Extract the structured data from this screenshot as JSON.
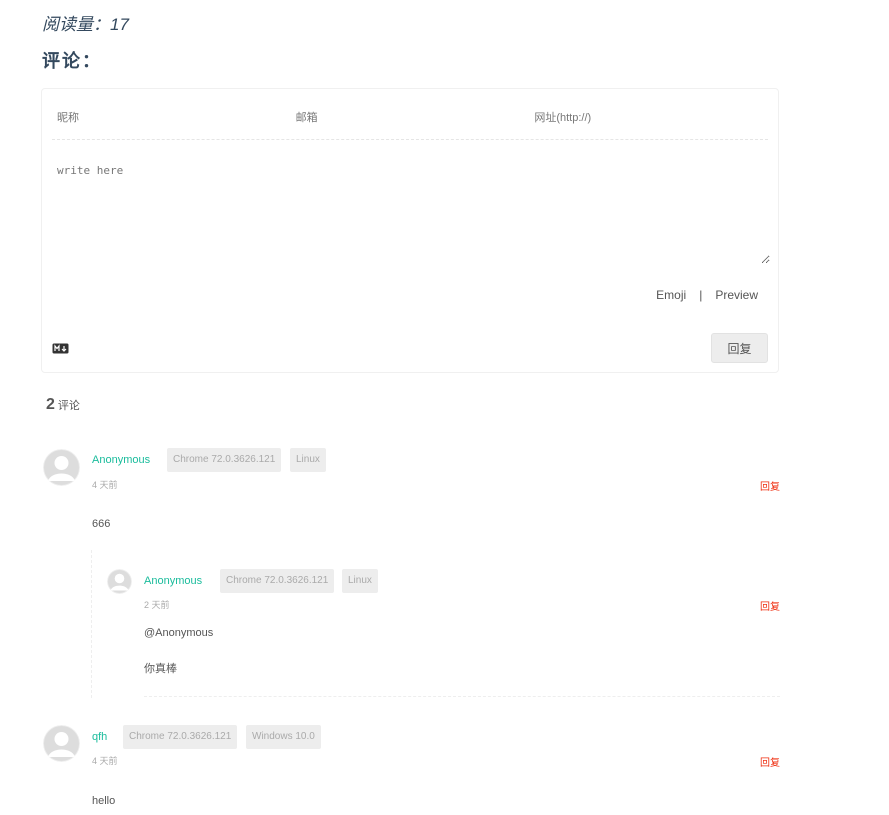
{
  "read_count": "阅读量：17",
  "section_title": "评论：",
  "form": {
    "nick_placeholder": "昵称",
    "mail_placeholder": "邮箱",
    "link_placeholder": "网址(http://)",
    "editor_placeholder": "write here",
    "emoji_label": "Emoji",
    "separator": "|",
    "preview_label": "Preview",
    "submit_label": "回复",
    "markdown_icon": "markdown-icon"
  },
  "count": {
    "number": "2",
    "label": "评论"
  },
  "comments": [
    {
      "nick": "Anonymous",
      "browser": "Chrome 72.0.3626.121",
      "os": "Linux",
      "time": "4 天前",
      "reply_label": "回复",
      "content": "666",
      "avatar_icon": "default-avatar-icon",
      "replies": [
        {
          "nick": "Anonymous",
          "browser": "Chrome 72.0.3626.121",
          "os": "Linux",
          "time": "2 天前",
          "reply_label": "回复",
          "mention": "@Anonymous",
          "content": "你真棒",
          "avatar_icon": "default-avatar-icon"
        }
      ]
    },
    {
      "nick": "qfh",
      "browser": "Chrome 72.0.3626.121",
      "os": "Windows 10.0",
      "time": "4 天前",
      "reply_label": "回复",
      "content": "hello",
      "avatar_icon": "default-avatar-icon"
    }
  ],
  "colors": {
    "nick": "#1abc9c",
    "reply_link": "#ef2f11",
    "title": "#34495e",
    "badge_bg": "#ededed"
  }
}
